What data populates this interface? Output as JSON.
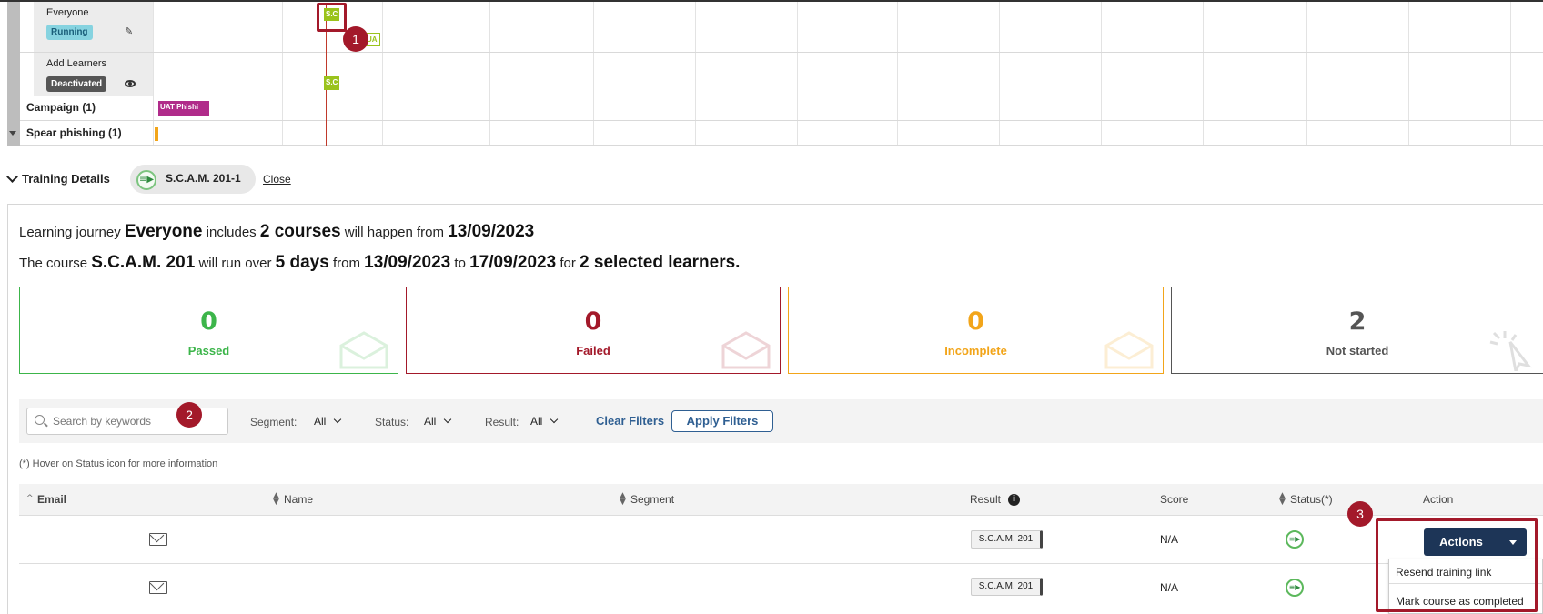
{
  "gantt": {
    "rows": [
      {
        "name": "Everyone",
        "badge": "Running",
        "action_icon": "pencil-icon"
      },
      {
        "name": "Add Learners",
        "badge": "Deactivated",
        "action_icon": "eye-icon"
      }
    ],
    "groups": [
      {
        "label": "Campaign (1)"
      },
      {
        "label": "Spear phishing (1)"
      }
    ],
    "bars": {
      "scam_top": "S.C",
      "uat_small": "UA",
      "scam_second": "S.C",
      "campaign": "UAT Phishi"
    }
  },
  "markers": [
    "1",
    "2",
    "3"
  ],
  "training_details": {
    "title": "Training Details",
    "pill_label": "S.C.A.M. 201-1",
    "close_label": "Close"
  },
  "summary": {
    "line1": {
      "t1": "Learning journey",
      "journey": "Everyone",
      "t2": "includes",
      "courses": "2 courses",
      "t3": "will happen from",
      "date": "13/09/2023"
    },
    "line2": {
      "t1": "The course",
      "course": "S.C.A.M. 201",
      "t2": "will run over",
      "days": "5 days",
      "t3": "from",
      "from": "13/09/2023",
      "t4": "to",
      "to": "17/09/2023",
      "t5": "for",
      "learners": "2 selected learners."
    }
  },
  "stats": [
    {
      "value": "0",
      "label": "Passed",
      "color": "#3cb54a"
    },
    {
      "value": "0",
      "label": "Failed",
      "color": "#a3192a"
    },
    {
      "value": "0",
      "label": "Incomplete",
      "color": "#f2a51a"
    },
    {
      "value": "2",
      "label": "Not started",
      "color": "#555555"
    }
  ],
  "filters": {
    "search_placeholder": "Search by keywords",
    "segment_label": "Segment:",
    "segment_value": "All",
    "status_label": "Status:",
    "status_value": "All",
    "result_label": "Result:",
    "result_value": "All",
    "clear_label": "Clear Filters",
    "apply_label": "Apply Filters"
  },
  "hint": "(*) Hover on Status icon for more information",
  "table": {
    "headers": {
      "email": "Email",
      "name": "Name",
      "segment": "Segment",
      "result": "Result",
      "score": "Score",
      "status": "Status(*)",
      "action": "Action"
    },
    "rows": [
      {
        "result": "S.C.A.M. 201",
        "score": "N/A"
      },
      {
        "result": "S.C.A.M. 201",
        "score": "N/A"
      }
    ]
  },
  "actions": {
    "button_label": "Actions",
    "menu": [
      "Resend training link",
      "Mark course as completed"
    ]
  },
  "colors": {
    "accent": "#1d3557",
    "highlight": "#a3192a",
    "link": "#2f5f92"
  }
}
